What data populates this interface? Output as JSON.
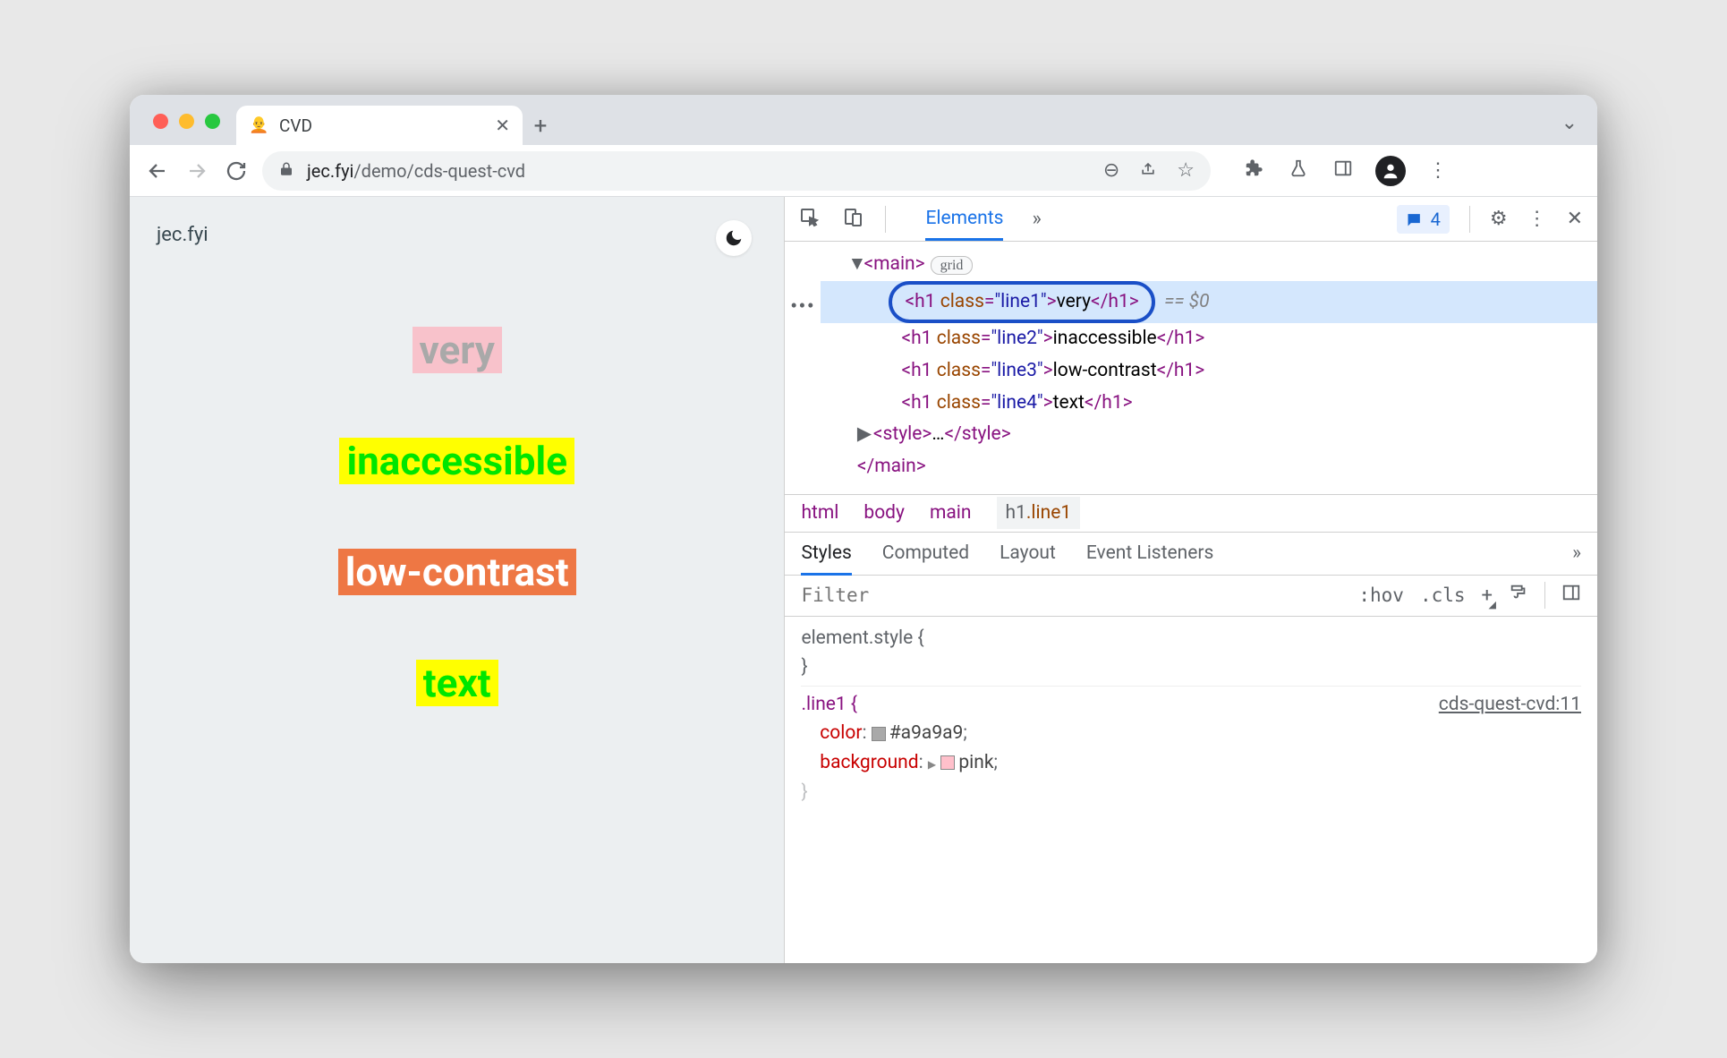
{
  "tab": {
    "title": "CVD"
  },
  "toolbar": {
    "domain": "jec.fyi",
    "path": "/demo/cds-quest-cvd"
  },
  "page": {
    "brand": "jec.fyi",
    "line1": "very",
    "line2": "inaccessible",
    "line3": "low-contrast",
    "line4": "text"
  },
  "devtools": {
    "tab_elements": "Elements",
    "issues_count": "4",
    "dom": {
      "main_open": "<main>",
      "main_badge": "grid",
      "h1_open": "<h1 ",
      "h1_class": "class",
      "line1_val": "\"line1\"",
      "line1_txt": "very",
      "line2_val": "\"line2\"",
      "line2_txt": "inaccessible",
      "line3_val": "\"line3\"",
      "line3_txt": "low-contrast",
      "line4_val": "\"line4\"",
      "line4_txt": "text",
      "h1_close": "</h1>",
      "eq0": "== $0",
      "style_open": "<style>",
      "ellipsis": "…",
      "style_close": "</style>",
      "main_close": "</main>"
    },
    "breadcrumb": {
      "html": "html",
      "body": "body",
      "main": "main",
      "current": "h1",
      "current_class": ".line1"
    },
    "styles_tabs": {
      "styles": "Styles",
      "computed": "Computed",
      "layout": "Layout",
      "events": "Event Listeners"
    },
    "filter": {
      "placeholder": "Filter",
      "hov": ":hov",
      "cls": ".cls"
    },
    "css": {
      "elstyle": "element.style {",
      "close": "}",
      "selector": ".line1 {",
      "src": "cds-quest-cvd:11",
      "p1_name": "color",
      "p1_val": "#a9a9a9",
      "p2_name": "background",
      "p2_val": "pink"
    }
  }
}
